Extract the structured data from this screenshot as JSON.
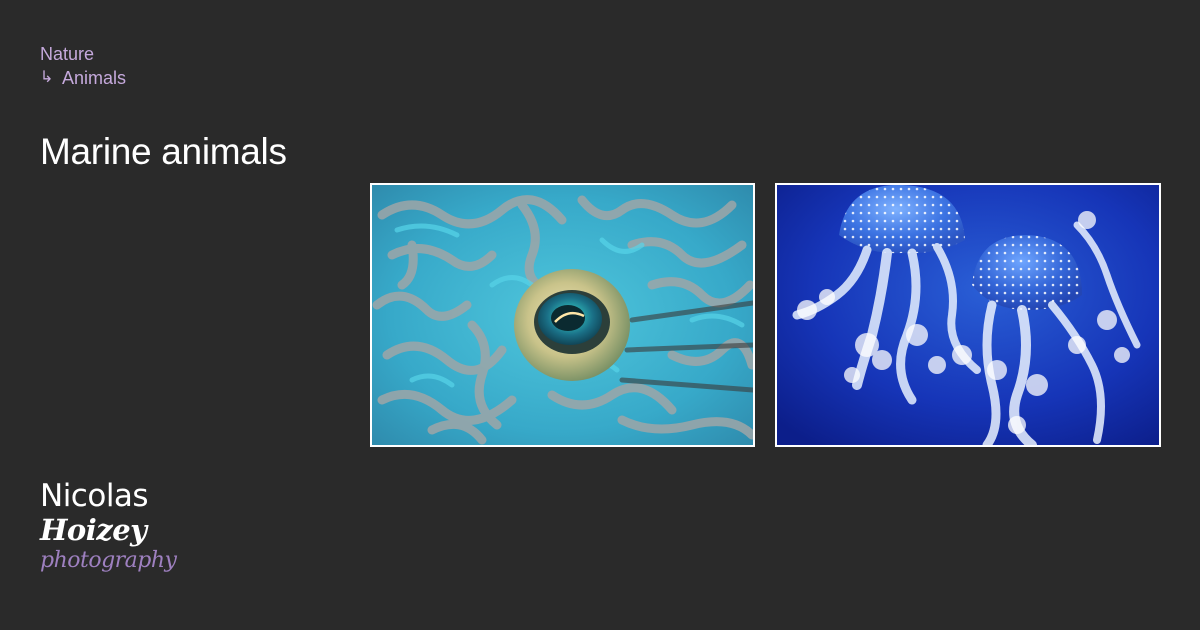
{
  "colors": {
    "background": "#2a2a2a",
    "breadcrumb": "#c5a9dc",
    "title": "#ffffff",
    "thumbnail_border": "#ffffff",
    "logo_primary": "#ffffff",
    "logo_accent": "#9e80c0"
  },
  "breadcrumb": {
    "parent": "Nature",
    "current_arrow_icon": "return-arrow-icon",
    "arrow_glyph": "↳",
    "current": "Animals"
  },
  "title": "Marine animals",
  "gallery": [
    {
      "name": "fish-eye-photo",
      "subject": "close-up of a colorful fish eye with blue maze-like skin pattern"
    },
    {
      "name": "jellyfish-photo",
      "subject": "two white-spotted jellyfish on deep blue water"
    }
  ],
  "logo": {
    "line1": "Nicolas",
    "line2": "Hoizey",
    "line3": "photography"
  }
}
